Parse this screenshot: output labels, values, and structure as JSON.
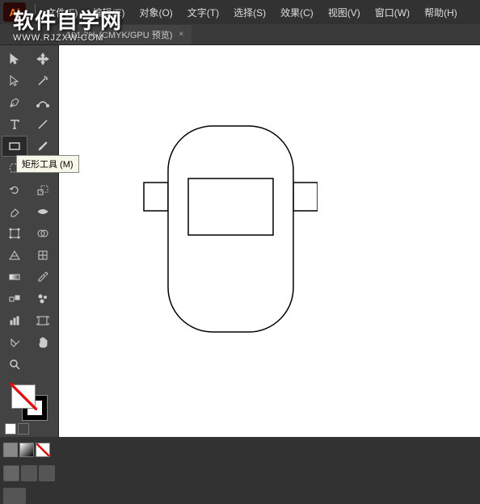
{
  "app": {
    "logo": "Ai"
  },
  "menu": {
    "file": "文件(F)",
    "edit": "编辑(E)",
    "object": "对象(O)",
    "type": "文字(T)",
    "select": "选择(S)",
    "effect": "效果(C)",
    "view": "视图(V)",
    "window": "窗口(W)",
    "help": "帮助(H)"
  },
  "tab": {
    "label": "101.7% (CMYK/GPU 预览)",
    "close": "×"
  },
  "tooltip": {
    "rectangle_tool": "矩形工具 (M)"
  },
  "watermark": {
    "title": "软件自学网",
    "url": "WWW.RJZXW.COM"
  },
  "tools": {
    "selection": "selection",
    "direct_selection": "direct-selection",
    "magic_wand": "magic-wand",
    "lasso": "lasso",
    "pen": "pen",
    "curvature": "curvature",
    "type": "type",
    "line": "line",
    "rectangle": "rectangle",
    "brush": "brush",
    "shaper": "shaper",
    "pencil": "pencil",
    "eraser": "eraser",
    "rotate": "rotate",
    "scissors": "scissors",
    "scale": "scale",
    "width": "width",
    "free_transform": "free-transform",
    "shape_builder": "shape-builder",
    "perspective": "perspective",
    "mesh": "mesh",
    "gradient": "gradient",
    "eyedropper": "eyedropper",
    "blend": "blend",
    "symbol": "symbol",
    "graph": "graph",
    "artboard": "artboard",
    "slice": "slice",
    "hand": "hand",
    "zoom": "zoom"
  }
}
